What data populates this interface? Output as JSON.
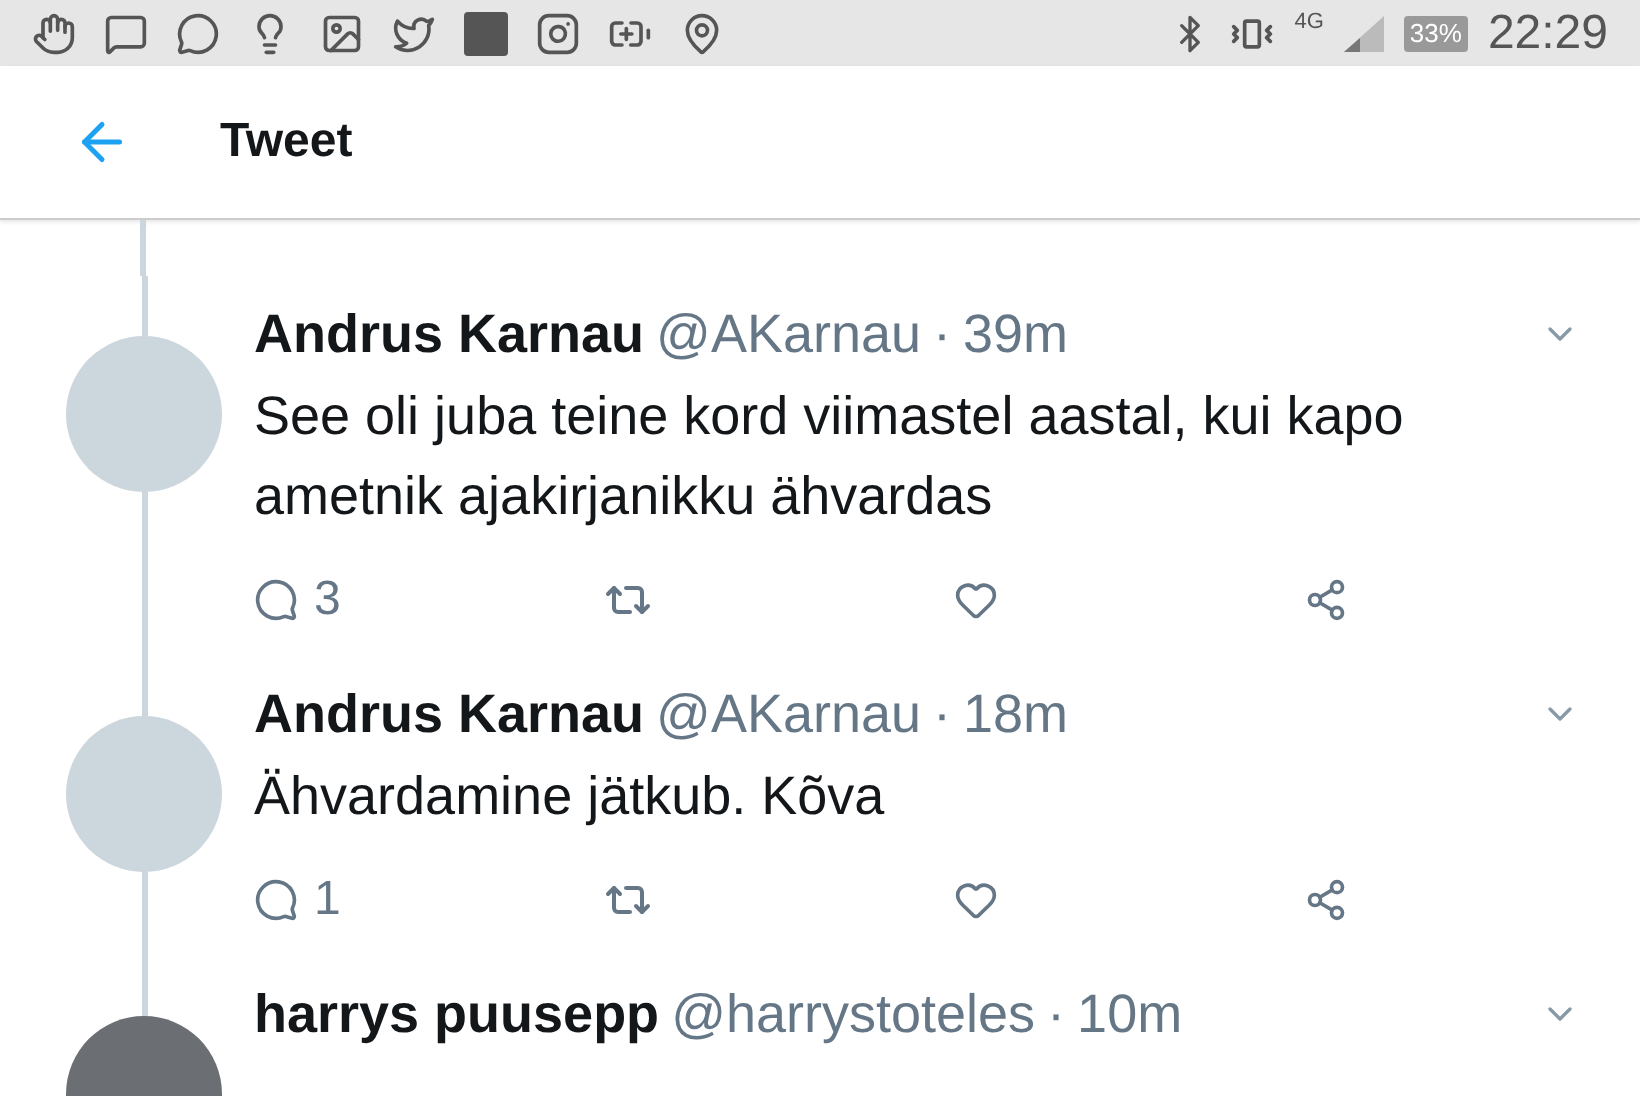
{
  "status_bar": {
    "network": "4G",
    "battery": "33%",
    "time": "22:29"
  },
  "header": {
    "title": "Tweet"
  },
  "tweets": [
    {
      "kind": "blank",
      "name": "Andrus Karnau",
      "handle": "@AKarnau",
      "separator": "·",
      "time": "39m",
      "text": "See oli juba teine kord viimastel aastal, kui kapo ametnik ajakirjanikku ähvardas",
      "replies": "3"
    },
    {
      "kind": "blank",
      "name": "Andrus Karnau",
      "handle": "@AKarnau",
      "separator": "·",
      "time": "18m",
      "text": "Ähvardamine jätkub. Kõva",
      "replies": "1"
    },
    {
      "kind": "photo",
      "name": "harrys puusepp",
      "handle": "@harrystoteles",
      "separator": "·",
      "time": "10m"
    }
  ]
}
